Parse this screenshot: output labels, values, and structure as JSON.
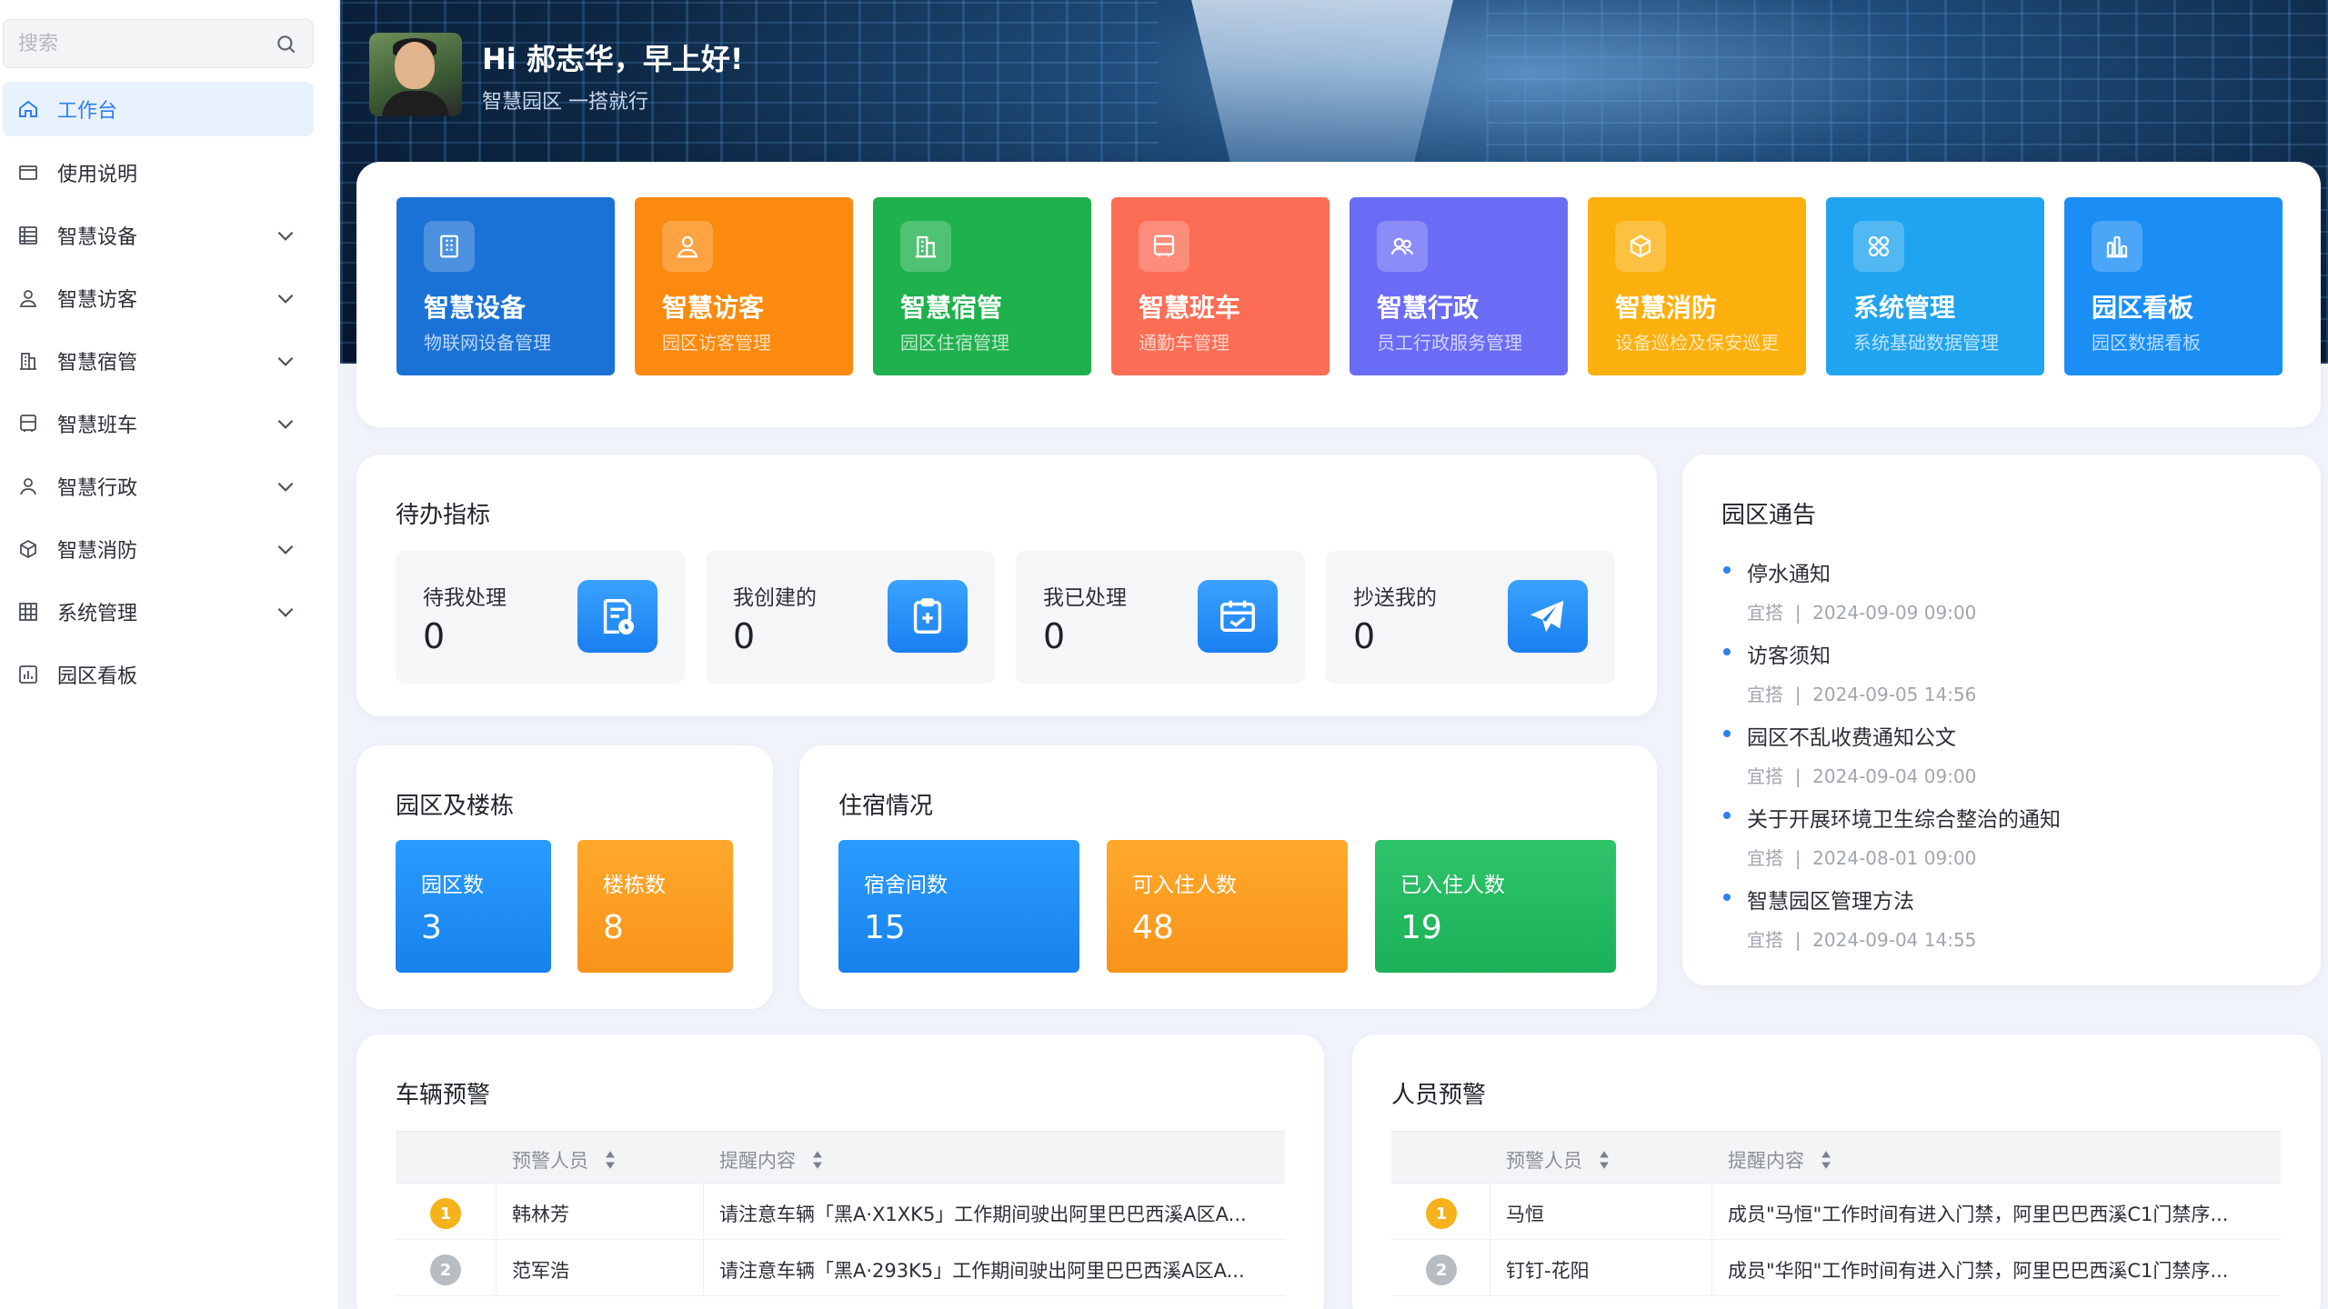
{
  "sidebar": {
    "search_placeholder": "搜索",
    "items": [
      {
        "label": "工作台",
        "icon": "home-icon",
        "active": true,
        "expandable": false
      },
      {
        "label": "使用说明",
        "icon": "window-icon",
        "active": false,
        "expandable": false
      },
      {
        "label": "智慧设备",
        "icon": "list-icon",
        "active": false,
        "expandable": true
      },
      {
        "label": "智慧访客",
        "icon": "user-icon",
        "active": false,
        "expandable": true
      },
      {
        "label": "智慧宿管",
        "icon": "building-icon",
        "active": false,
        "expandable": true
      },
      {
        "label": "智慧班车",
        "icon": "bus-icon",
        "active": false,
        "expandable": true
      },
      {
        "label": "智慧行政",
        "icon": "person-icon",
        "active": false,
        "expandable": true
      },
      {
        "label": "智慧消防",
        "icon": "box-icon",
        "active": false,
        "expandable": true
      },
      {
        "label": "系统管理",
        "icon": "grid-icon",
        "active": false,
        "expandable": true
      },
      {
        "label": "园区看板",
        "icon": "chart-icon",
        "active": false,
        "expandable": false
      }
    ]
  },
  "header": {
    "greeting": "Hi 郝志华，早上好!",
    "subtitle": "智慧园区 一搭就行"
  },
  "modules": [
    {
      "title": "智慧设备",
      "subtitle": "物联网设备管理",
      "color": "#1a72d6",
      "icon": "device-icon"
    },
    {
      "title": "智慧访客",
      "subtitle": "园区访客管理",
      "color": "#fb8a0e",
      "icon": "visitor-icon"
    },
    {
      "title": "智慧宿管",
      "subtitle": "园区住宿管理",
      "color": "#1fb14d",
      "icon": "dorm-icon"
    },
    {
      "title": "智慧班车",
      "subtitle": "通勤车管理",
      "color": "#fb6e55",
      "icon": "bus-icon"
    },
    {
      "title": "智慧行政",
      "subtitle": "员工行政服务管理",
      "color": "#6b6cf5",
      "icon": "admin-icon"
    },
    {
      "title": "智慧消防",
      "subtitle": "设备巡检及保安巡更",
      "color": "#fbb00e",
      "icon": "fire-icon"
    },
    {
      "title": "系统管理",
      "subtitle": "系统基础数据管理",
      "color": "#21a4ef",
      "icon": "system-icon"
    },
    {
      "title": "园区看板",
      "subtitle": "园区数据看板",
      "color": "#1a8ef5",
      "icon": "dashboard-icon"
    }
  ],
  "todo": {
    "title": "待办指标",
    "cards": [
      {
        "label": "待我处理",
        "value": "0",
        "icon": "pending-doc-icon"
      },
      {
        "label": "我创建的",
        "value": "0",
        "icon": "clipboard-add-icon"
      },
      {
        "label": "我已处理",
        "value": "0",
        "icon": "calendar-check-icon"
      },
      {
        "label": "抄送我的",
        "value": "0",
        "icon": "send-icon"
      }
    ]
  },
  "notices": {
    "title": "园区通告",
    "items": [
      {
        "title": "停水通知",
        "author": "宜搭",
        "date": "2024-09-09 09:00"
      },
      {
        "title": "访客须知",
        "author": "宜搭",
        "date": "2024-09-05 14:56"
      },
      {
        "title": "园区不乱收费通知公文",
        "author": "宜搭",
        "date": "2024-09-04 09:00"
      },
      {
        "title": "关于开展环境卫生综合整治的通知",
        "author": "宜搭",
        "date": "2024-08-01 09:00"
      },
      {
        "title": "智慧园区管理方法",
        "author": "宜搭",
        "date": "2024-09-04 14:55"
      }
    ]
  },
  "park": {
    "title": "园区及楼栋",
    "stats": [
      {
        "label": "园区数",
        "value": "3"
      },
      {
        "label": "楼栋数",
        "value": "8"
      }
    ]
  },
  "dorm": {
    "title": "住宿情况",
    "stats": [
      {
        "label": "宿舍间数",
        "value": "15"
      },
      {
        "label": "可入住人数",
        "value": "48"
      },
      {
        "label": "已入住人数",
        "value": "19"
      }
    ]
  },
  "vehicle_alert": {
    "title": "车辆预警",
    "col_person": "预警人员",
    "col_content": "提醒内容",
    "rows": [
      {
        "rank": "1",
        "person": "韩林芳",
        "content": "请注意车辆「黑A·X1XK5」工作期间驶出阿里巴巴西溪A区A..."
      },
      {
        "rank": "2",
        "person": "范军浩",
        "content": "请注意车辆「黑A·293K5」工作期间驶出阿里巴巴西溪A区A..."
      }
    ]
  },
  "person_alert": {
    "title": "人员预警",
    "col_person": "预警人员",
    "col_content": "提醒内容",
    "rows": [
      {
        "rank": "1",
        "person": "马恒",
        "content": "成员\"马恒\"工作时间有进入门禁，阿里巴巴西溪C1门禁序..."
      },
      {
        "rank": "2",
        "person": "钉钉-花阳",
        "content": "成员\"华阳\"工作时间有进入门禁，阿里巴巴西溪C1门禁序..."
      }
    ]
  }
}
